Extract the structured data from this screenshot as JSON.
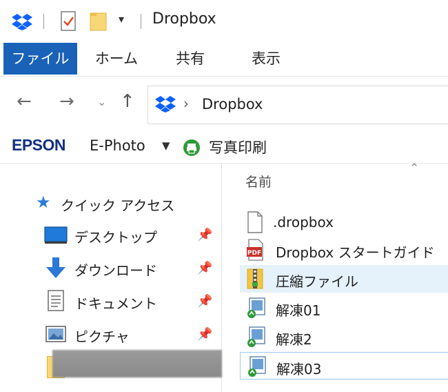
{
  "window": {
    "title": "Dropbox"
  },
  "ribbon": {
    "tabs": [
      "ファイル",
      "ホーム",
      "共有",
      "表示"
    ]
  },
  "address": {
    "segment": "Dropbox"
  },
  "epson": {
    "logo": "EPSON",
    "app": "E-Photo",
    "action": "写真印刷"
  },
  "nav": {
    "quick_access": "クイック アクセス",
    "items": [
      {
        "label": "デスクトップ",
        "icon": "desktop-icon"
      },
      {
        "label": "ダウンロード",
        "icon": "download-arrow-icon"
      },
      {
        "label": "ドキュメント",
        "icon": "document-icon"
      },
      {
        "label": "ピクチャ",
        "icon": "picture-icon"
      }
    ]
  },
  "content": {
    "column_name": "名前",
    "files": [
      {
        "name": ".dropbox",
        "icon": "blank-file-icon"
      },
      {
        "name": "Dropbox スタートガイド",
        "icon": "pdf-file-icon"
      },
      {
        "name": "圧縮ファイル",
        "icon": "zip-folder-icon"
      },
      {
        "name": "解凍01",
        "icon": "shortcut-file-icon"
      },
      {
        "name": "解凍2",
        "icon": "shortcut-file-icon"
      },
      {
        "name": "解凍03",
        "icon": "shortcut-file-icon"
      }
    ]
  },
  "colors": {
    "accent": "#1a62b8",
    "dropbox_blue": "#0d61fe",
    "selection": "#e5f1fb",
    "epson_blue": "#13307f"
  }
}
